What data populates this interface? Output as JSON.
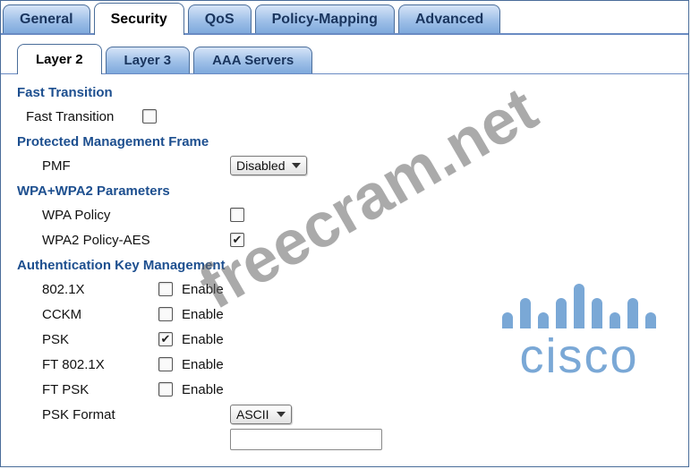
{
  "top_tabs": {
    "general": "General",
    "security": "Security",
    "qos": "QoS",
    "policy_mapping": "Policy-Mapping",
    "advanced": "Advanced"
  },
  "sub_tabs": {
    "layer2": "Layer 2",
    "layer3": "Layer 3",
    "aaa": "AAA Servers"
  },
  "sections": {
    "fast_transition_title": "Fast Transition",
    "fast_transition_label": "Fast Transition",
    "pmf_title": "Protected Management Frame",
    "pmf_label": "PMF",
    "pmf_value": "Disabled",
    "wpa_title": "WPA+WPA2 Parameters",
    "wpa_policy": "WPA Policy",
    "wpa2_policy_aes": "WPA2 Policy-AES",
    "akm_title": "Authentication Key Management",
    "akm": {
      "dot1x": "802.1X",
      "cckm": "CCKM",
      "psk": "PSK",
      "ft_dot1x": "FT 802.1X",
      "ft_psk": "FT PSK"
    },
    "enable_text": "Enable",
    "psk_format_label": "PSK Format",
    "psk_format_value": "ASCII"
  },
  "watermark": "freecram.net",
  "cisco": "cisco"
}
